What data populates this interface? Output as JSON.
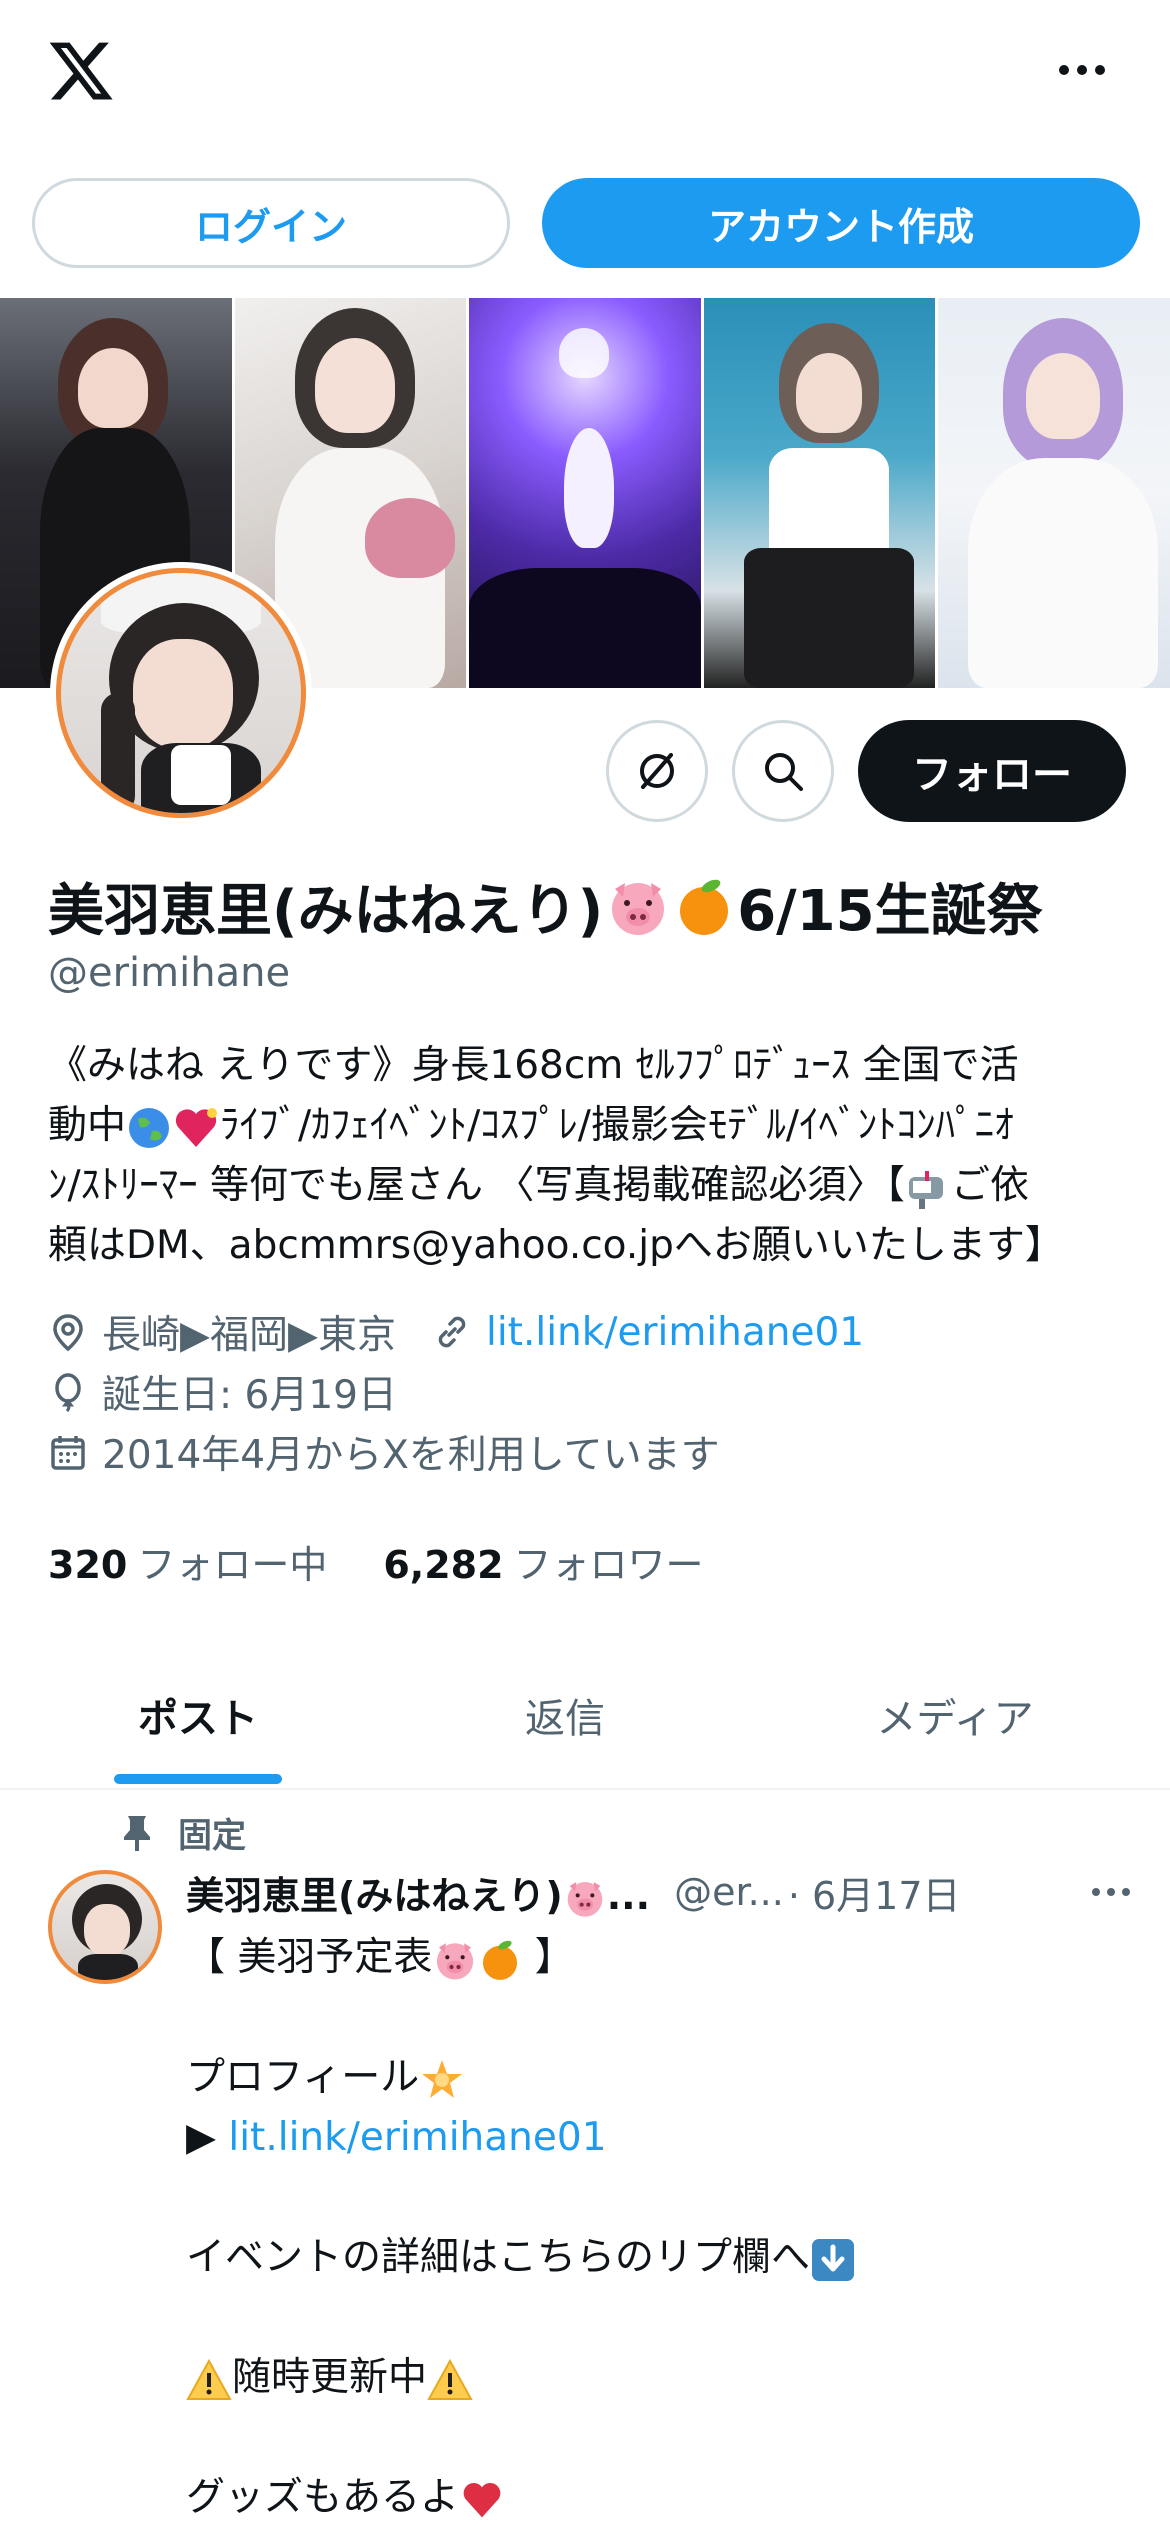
{
  "topbar": {
    "logo_icon": "x-logo-icon",
    "more_icon": "more-icon"
  },
  "auth": {
    "login_label": "ログイン",
    "signup_label": "アカウント作成"
  },
  "banner": {
    "photo_count": 5
  },
  "actions": {
    "follow_label": "フォロー"
  },
  "profile": {
    "name_text": "美羽恵里(みはねえり)",
    "name_suffix": "6/15生誕祭",
    "handle": "@erimihane",
    "bio_lines": [
      "《みはね えりです》身長168cm ｾﾙﾌﾌﾟﾛﾃﾞｭｰｽ 全国で活",
      "ﾗｲﾌﾞ/ｶﾌｪｲﾍﾞﾝﾄ/ｺｽﾌﾟﾚ/撮影会ﾓﾃﾞﾙ/ｲﾍﾞﾝﾄｺﾝﾊﾟﾆｵ",
      "ﾝ/ｽﾄﾘｰﾏｰ 等何でも屋さん 〈写真掲載確認必須〉【",
      "ご依",
      "頼はDM、abcmmrs@yahoo.co.jpへお願いいたします】"
    ],
    "bio_line2_prefix": "動中",
    "location": "長崎▶福岡▶東京",
    "website": "lit.link/erimihane01",
    "birthday": "誕生日: 6月19日",
    "joined": "2014年4月からXを利用しています"
  },
  "stats": {
    "following_count": "320",
    "following_label": "フォロー中",
    "followers_count": "6,282",
    "followers_label": "フォロワー"
  },
  "tabs": [
    {
      "label": "ポスト",
      "active": true
    },
    {
      "label": "返信",
      "active": false
    },
    {
      "label": "メディア",
      "active": false
    }
  ],
  "post": {
    "pinned_label": "固定",
    "author_name": "美羽恵里(みはねえり)",
    "author_ellipsis": "...",
    "author_handle": "@er...",
    "date": "· 6月17日",
    "lines": {
      "title_open": "【 美羽予定表",
      "title_close": " 】",
      "profile": "プロフィール",
      "arrow": "▶ ",
      "link": "lit.link/erimihane01",
      "event": "イベントの詳細はこちらのリプ欄へ",
      "update": "随時更新中",
      "goods": "グッズもあるよ"
    }
  },
  "colors": {
    "accent": "#1d9bf0",
    "text": "#0f1419",
    "muted": "#536471",
    "avatar_ring": "#f08a3c"
  }
}
